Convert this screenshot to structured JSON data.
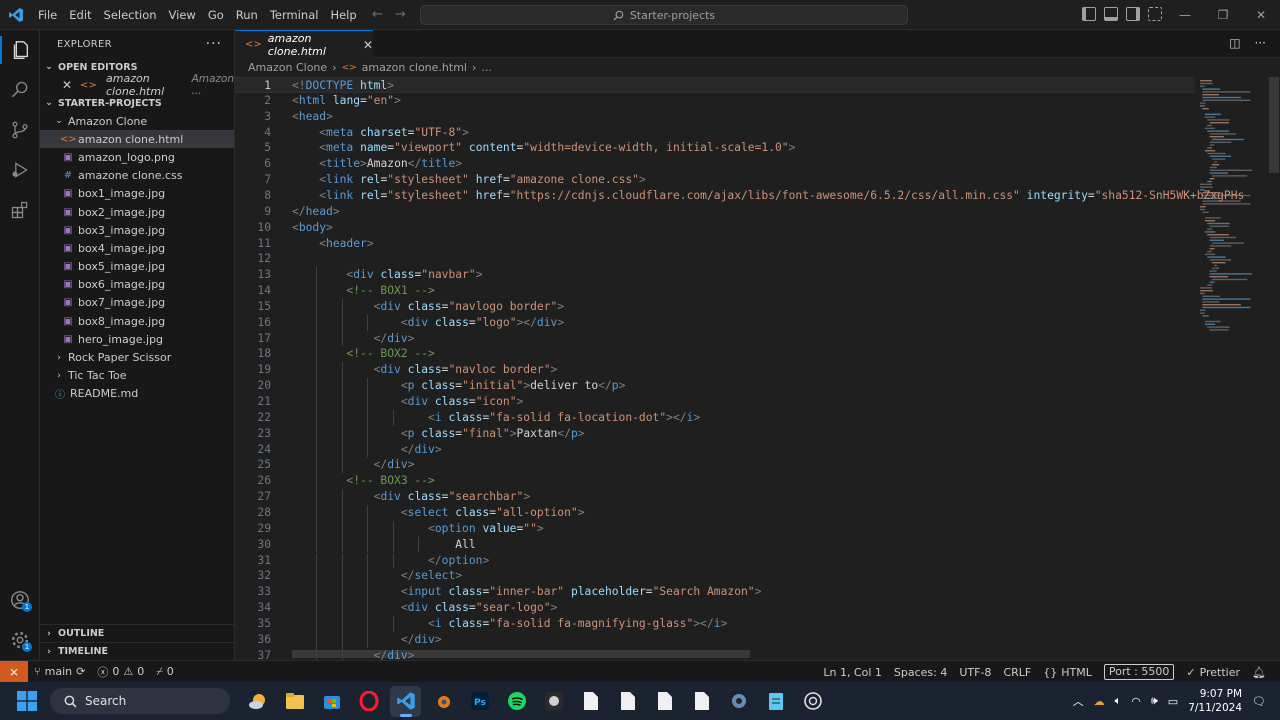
{
  "titlebar": {
    "menus": [
      "File",
      "Edit",
      "Selection",
      "View",
      "Go",
      "Run",
      "Terminal",
      "Help"
    ],
    "command_center": "Starter-projects"
  },
  "sidebar": {
    "explorer_title": "EXPLORER",
    "open_editors_title": "OPEN EDITORS",
    "open_editor_file": "amazon clone.html",
    "open_editor_path": "Amazon ...",
    "workspace_title": "STARTER-PROJECTS",
    "folder": "Amazon Clone",
    "files": [
      {
        "name": "amazon clone.html",
        "icon": "html-icon",
        "color": "#e37933"
      },
      {
        "name": "amazon_logo.png",
        "icon": "image-icon",
        "color": "#a074c4"
      },
      {
        "name": "amazone clone.css",
        "icon": "css-icon",
        "color": "#519aba"
      },
      {
        "name": "box1_image.jpg",
        "icon": "image-icon",
        "color": "#a074c4"
      },
      {
        "name": "box2_image.jpg",
        "icon": "image-icon",
        "color": "#a074c4"
      },
      {
        "name": "box3_image.jpg",
        "icon": "image-icon",
        "color": "#a074c4"
      },
      {
        "name": "box4_image.jpg",
        "icon": "image-icon",
        "color": "#a074c4"
      },
      {
        "name": "box5_image.jpg",
        "icon": "image-icon",
        "color": "#a074c4"
      },
      {
        "name": "box6_image.jpg",
        "icon": "image-icon",
        "color": "#a074c4"
      },
      {
        "name": "box7_image.jpg",
        "icon": "image-icon",
        "color": "#a074c4"
      },
      {
        "name": "box8_image.jpg",
        "icon": "image-icon",
        "color": "#a074c4"
      },
      {
        "name": "hero_image.jpg",
        "icon": "image-icon",
        "color": "#a074c4"
      }
    ],
    "other_folders": [
      "Rock Paper Scissor",
      "Tic Tac Toe"
    ],
    "readme": "README.md",
    "outline_title": "OUTLINE",
    "timeline_title": "TIMELINE"
  },
  "editor": {
    "tab_name": "amazon clone.html",
    "breadcrumb": [
      "Amazon Clone",
      "amazon clone.html",
      "..."
    ],
    "lines": [
      [
        [
          "p",
          "<!"
        ],
        [
          "tag",
          "DOCTYPE"
        ],
        [
          "t",
          " "
        ],
        [
          "attr",
          "html"
        ],
        [
          "p",
          ">"
        ]
      ],
      [
        [
          "p",
          "<"
        ],
        [
          "tag",
          "html"
        ],
        [
          "t",
          " "
        ],
        [
          "attr",
          "lang"
        ],
        [
          "t",
          "="
        ],
        [
          "str",
          "\"en\""
        ],
        [
          "p",
          ">"
        ]
      ],
      [
        [
          "p",
          "<"
        ],
        [
          "tag",
          "head"
        ],
        [
          "p",
          ">"
        ]
      ],
      [
        [
          "t",
          "    "
        ],
        [
          "p",
          "<"
        ],
        [
          "tag",
          "meta"
        ],
        [
          "t",
          " "
        ],
        [
          "attr",
          "charset"
        ],
        [
          "t",
          "="
        ],
        [
          "str",
          "\"UTF-8\""
        ],
        [
          "p",
          ">"
        ]
      ],
      [
        [
          "t",
          "    "
        ],
        [
          "p",
          "<"
        ],
        [
          "tag",
          "meta"
        ],
        [
          "t",
          " "
        ],
        [
          "attr",
          "name"
        ],
        [
          "t",
          "="
        ],
        [
          "str",
          "\"viewport\""
        ],
        [
          "t",
          " "
        ],
        [
          "attr",
          "content"
        ],
        [
          "t",
          "="
        ],
        [
          "str",
          "\"width=device-width, initial-scale=1.0\""
        ],
        [
          "p",
          ">"
        ]
      ],
      [
        [
          "t",
          "    "
        ],
        [
          "p",
          "<"
        ],
        [
          "tag",
          "title"
        ],
        [
          "p",
          ">"
        ],
        [
          "t",
          "Amazon"
        ],
        [
          "p",
          "</"
        ],
        [
          "tag",
          "title"
        ],
        [
          "p",
          ">"
        ]
      ],
      [
        [
          "t",
          "    "
        ],
        [
          "p",
          "<"
        ],
        [
          "tag",
          "link"
        ],
        [
          "t",
          " "
        ],
        [
          "attr",
          "rel"
        ],
        [
          "t",
          "="
        ],
        [
          "str",
          "\"stylesheet\""
        ],
        [
          "t",
          " "
        ],
        [
          "attr",
          "href"
        ],
        [
          "t",
          "="
        ],
        [
          "str",
          "\"amazone clone.css\""
        ],
        [
          "p",
          ">"
        ]
      ],
      [
        [
          "t",
          "    "
        ],
        [
          "p",
          "<"
        ],
        [
          "tag",
          "link"
        ],
        [
          "t",
          " "
        ],
        [
          "attr",
          "rel"
        ],
        [
          "t",
          "="
        ],
        [
          "str",
          "\"stylesheet\""
        ],
        [
          "t",
          " "
        ],
        [
          "attr",
          "href"
        ],
        [
          "t",
          "="
        ],
        [
          "str",
          "\"https://cdnjs.cloudflare.com/ajax/libs/font-awesome/6.5.2/css/all.min.css\""
        ],
        [
          "t",
          " "
        ],
        [
          "attr",
          "integrity"
        ],
        [
          "t",
          "="
        ],
        [
          "str",
          "\"sha512-SnH5WK+bZxgPHs"
        ]
      ],
      [
        [
          "p",
          "</"
        ],
        [
          "tag",
          "head"
        ],
        [
          "p",
          ">"
        ]
      ],
      [
        [
          "p",
          "<"
        ],
        [
          "tag",
          "body"
        ],
        [
          "p",
          ">"
        ]
      ],
      [
        [
          "t",
          "    "
        ],
        [
          "p",
          "<"
        ],
        [
          "tag",
          "header"
        ],
        [
          "p",
          ">"
        ]
      ],
      [
        [
          "t",
          ""
        ]
      ],
      [
        [
          "t",
          "        "
        ],
        [
          "p",
          "<"
        ],
        [
          "tag",
          "div"
        ],
        [
          "t",
          " "
        ],
        [
          "attr",
          "class"
        ],
        [
          "t",
          "="
        ],
        [
          "str",
          "\"navbar\""
        ],
        [
          "p",
          ">"
        ]
      ],
      [
        [
          "t",
          "        "
        ],
        [
          "com",
          "<!-- BOX1 -->"
        ]
      ],
      [
        [
          "t",
          "            "
        ],
        [
          "p",
          "<"
        ],
        [
          "tag",
          "div"
        ],
        [
          "t",
          " "
        ],
        [
          "attr",
          "class"
        ],
        [
          "t",
          "="
        ],
        [
          "str",
          "\"navlogo border\""
        ],
        [
          "p",
          ">"
        ]
      ],
      [
        [
          "t",
          "                "
        ],
        [
          "p",
          "<"
        ],
        [
          "tag",
          "div"
        ],
        [
          "t",
          " "
        ],
        [
          "attr",
          "class"
        ],
        [
          "t",
          "="
        ],
        [
          "str",
          "\"logo\""
        ],
        [
          "p",
          "></"
        ],
        [
          "tag",
          "div"
        ],
        [
          "p",
          ">"
        ]
      ],
      [
        [
          "t",
          "            "
        ],
        [
          "p",
          "</"
        ],
        [
          "tag",
          "div"
        ],
        [
          "p",
          ">"
        ]
      ],
      [
        [
          "t",
          "        "
        ],
        [
          "com",
          "<!-- BOX2 -->"
        ]
      ],
      [
        [
          "t",
          "            "
        ],
        [
          "p",
          "<"
        ],
        [
          "tag",
          "div"
        ],
        [
          "t",
          " "
        ],
        [
          "attr",
          "class"
        ],
        [
          "t",
          "="
        ],
        [
          "str",
          "\"navloc border\""
        ],
        [
          "p",
          ">"
        ]
      ],
      [
        [
          "t",
          "                "
        ],
        [
          "p",
          "<"
        ],
        [
          "tag",
          "p"
        ],
        [
          "t",
          " "
        ],
        [
          "attr",
          "class"
        ],
        [
          "t",
          "="
        ],
        [
          "str",
          "\"initial\""
        ],
        [
          "p",
          ">"
        ],
        [
          "t",
          "deliver to"
        ],
        [
          "p",
          "</"
        ],
        [
          "tag",
          "p"
        ],
        [
          "p",
          ">"
        ]
      ],
      [
        [
          "t",
          "                "
        ],
        [
          "p",
          "<"
        ],
        [
          "tag",
          "div"
        ],
        [
          "t",
          " "
        ],
        [
          "attr",
          "class"
        ],
        [
          "t",
          "="
        ],
        [
          "str",
          "\"icon\""
        ],
        [
          "p",
          ">"
        ]
      ],
      [
        [
          "t",
          "                    "
        ],
        [
          "p",
          "<"
        ],
        [
          "tag",
          "i"
        ],
        [
          "t",
          " "
        ],
        [
          "attr",
          "class"
        ],
        [
          "t",
          "="
        ],
        [
          "str",
          "\"fa-solid fa-location-dot\""
        ],
        [
          "p",
          "></"
        ],
        [
          "tag",
          "i"
        ],
        [
          "p",
          ">"
        ]
      ],
      [
        [
          "t",
          "                "
        ],
        [
          "p",
          "<"
        ],
        [
          "tag",
          "p"
        ],
        [
          "t",
          " "
        ],
        [
          "attr",
          "class"
        ],
        [
          "t",
          "="
        ],
        [
          "str",
          "\"final\""
        ],
        [
          "p",
          ">"
        ],
        [
          "t",
          "Paxtan"
        ],
        [
          "p",
          "</"
        ],
        [
          "tag",
          "p"
        ],
        [
          "p",
          ">"
        ]
      ],
      [
        [
          "t",
          "                "
        ],
        [
          "p",
          "</"
        ],
        [
          "tag",
          "div"
        ],
        [
          "p",
          ">"
        ]
      ],
      [
        [
          "t",
          "            "
        ],
        [
          "p",
          "</"
        ],
        [
          "tag",
          "div"
        ],
        [
          "p",
          ">"
        ]
      ],
      [
        [
          "t",
          "        "
        ],
        [
          "com",
          "<!-- BOX3 -->"
        ]
      ],
      [
        [
          "t",
          "            "
        ],
        [
          "p",
          "<"
        ],
        [
          "tag",
          "div"
        ],
        [
          "t",
          " "
        ],
        [
          "attr",
          "class"
        ],
        [
          "t",
          "="
        ],
        [
          "str",
          "\"searchbar\""
        ],
        [
          "p",
          ">"
        ]
      ],
      [
        [
          "t",
          "                "
        ],
        [
          "p",
          "<"
        ],
        [
          "tag",
          "select"
        ],
        [
          "t",
          " "
        ],
        [
          "attr",
          "class"
        ],
        [
          "t",
          "="
        ],
        [
          "str",
          "\"all-option\""
        ],
        [
          "p",
          ">"
        ]
      ],
      [
        [
          "t",
          "                    "
        ],
        [
          "p",
          "<"
        ],
        [
          "tag",
          "option"
        ],
        [
          "t",
          " "
        ],
        [
          "attr",
          "value"
        ],
        [
          "t",
          "="
        ],
        [
          "str",
          "\"\""
        ],
        [
          "p",
          ">"
        ]
      ],
      [
        [
          "t",
          "                        All"
        ]
      ],
      [
        [
          "t",
          "                    "
        ],
        [
          "p",
          "</"
        ],
        [
          "tag",
          "option"
        ],
        [
          "p",
          ">"
        ]
      ],
      [
        [
          "t",
          "                "
        ],
        [
          "p",
          "</"
        ],
        [
          "tag",
          "select"
        ],
        [
          "p",
          ">"
        ]
      ],
      [
        [
          "t",
          "                "
        ],
        [
          "p",
          "<"
        ],
        [
          "tag",
          "input"
        ],
        [
          "t",
          " "
        ],
        [
          "attr",
          "class"
        ],
        [
          "t",
          "="
        ],
        [
          "str",
          "\"inner-bar\""
        ],
        [
          "t",
          " "
        ],
        [
          "attr",
          "placeholder"
        ],
        [
          "t",
          "="
        ],
        [
          "str",
          "\"Search Amazon\""
        ],
        [
          "p",
          ">"
        ]
      ],
      [
        [
          "t",
          "                "
        ],
        [
          "p",
          "<"
        ],
        [
          "tag",
          "div"
        ],
        [
          "t",
          " "
        ],
        [
          "attr",
          "class"
        ],
        [
          "t",
          "="
        ],
        [
          "str",
          "\"sear-logo\""
        ],
        [
          "p",
          ">"
        ]
      ],
      [
        [
          "t",
          "                    "
        ],
        [
          "p",
          "<"
        ],
        [
          "tag",
          "i"
        ],
        [
          "t",
          " "
        ],
        [
          "attr",
          "class"
        ],
        [
          "t",
          "="
        ],
        [
          "str",
          "\"fa-solid fa-magnifying-glass\""
        ],
        [
          "p",
          "></"
        ],
        [
          "tag",
          "i"
        ],
        [
          "p",
          ">"
        ]
      ],
      [
        [
          "t",
          "                "
        ],
        [
          "p",
          "</"
        ],
        [
          "tag",
          "div"
        ],
        [
          "p",
          ">"
        ]
      ],
      [
        [
          "t",
          "            "
        ],
        [
          "p",
          "</"
        ],
        [
          "tag",
          "div"
        ],
        [
          "p",
          ">"
        ]
      ]
    ]
  },
  "statusbar": {
    "branch": "main",
    "errors": "0",
    "warnings": "0",
    "ports": "0",
    "position": "Ln 1, Col 1",
    "spaces": "Spaces: 4",
    "encoding": "UTF-8",
    "eol": "CRLF",
    "language": "HTML",
    "port": "Port : 5500",
    "prettier": "Prettier"
  },
  "taskbar": {
    "search_label": "Search",
    "time": "9:07 PM",
    "date": "7/11/2024"
  }
}
